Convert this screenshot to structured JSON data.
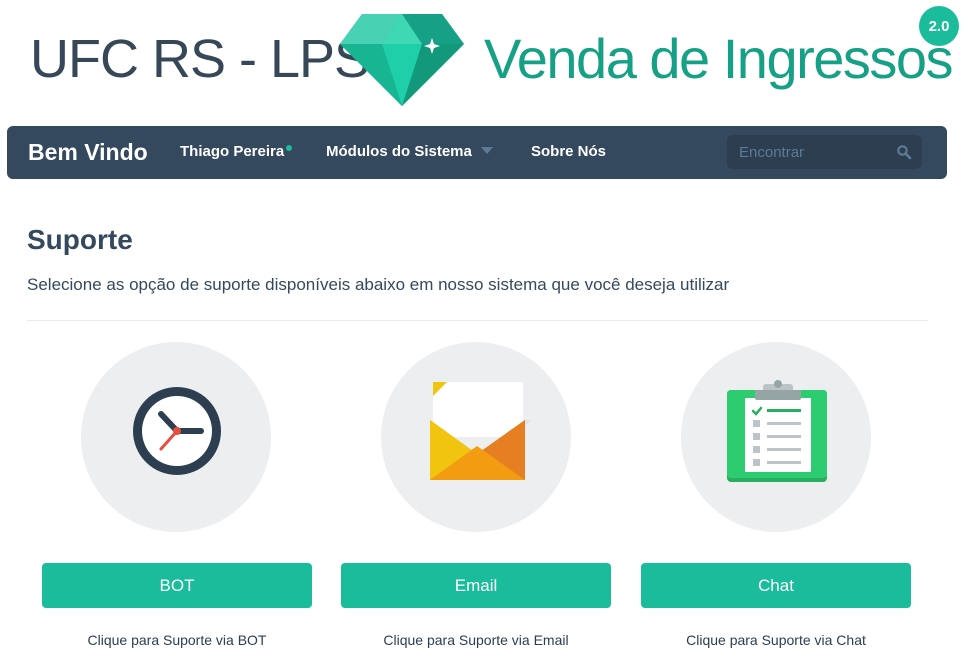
{
  "header": {
    "org_title": "UFC RS - LPS",
    "app_title": "Venda de Ingressos",
    "version": "2.0",
    "logo_icon": "diamond-icon"
  },
  "navbar": {
    "brand": "Bem Vindo",
    "user": "Thiago Pereira",
    "modules": "Módulos do Sistema",
    "about": "Sobre Nós",
    "search_placeholder": "Encontrar",
    "search_value": ""
  },
  "content": {
    "title": "Suporte",
    "subtitle": "Selecione as opção de suporte disponíveis abaixo em nosso sistema que você deseja utilizar"
  },
  "options": [
    {
      "icon": "clock-icon",
      "button": "BOT",
      "caption": "Clique para Suporte via BOT"
    },
    {
      "icon": "envelope-icon",
      "button": "Email",
      "caption": "Clique para Suporte via Email"
    },
    {
      "icon": "clipboard-icon",
      "button": "Chat",
      "caption": "Clique para Suporte via Chat"
    }
  ],
  "colors": {
    "accent": "#1abc9c",
    "navbar": "#34495e",
    "app_title": "#16a085",
    "text": "#34495e"
  }
}
